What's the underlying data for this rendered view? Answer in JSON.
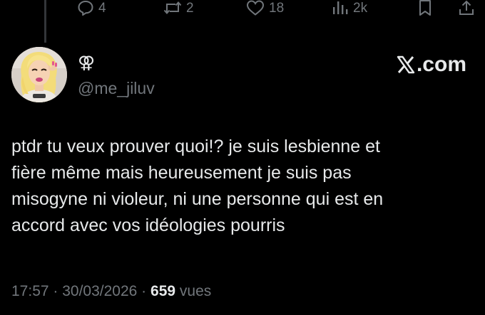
{
  "actions": {
    "reply_count": "4",
    "repost_count": "2",
    "like_count": "18",
    "views_count": "2k"
  },
  "author": {
    "display_name": "⚢",
    "handle": "@me_jiluv"
  },
  "brand": {
    "label": ".com"
  },
  "tweet": {
    "text": "ptdr tu veux prouver quoi!? je suis lesbienne et\nfière même mais heureusement  je suis pas\nmisogyne ni violeur, ni une personne qui est en\naccord avec vos idéologies pourris"
  },
  "meta": {
    "time": "17:57",
    "separator": " · ",
    "date": "30/03/2026",
    "views_value": "659",
    "views_label": " vues"
  },
  "colors": {
    "background": "#000000",
    "text_primary": "#e7e9ea",
    "text_secondary": "#71767b"
  }
}
